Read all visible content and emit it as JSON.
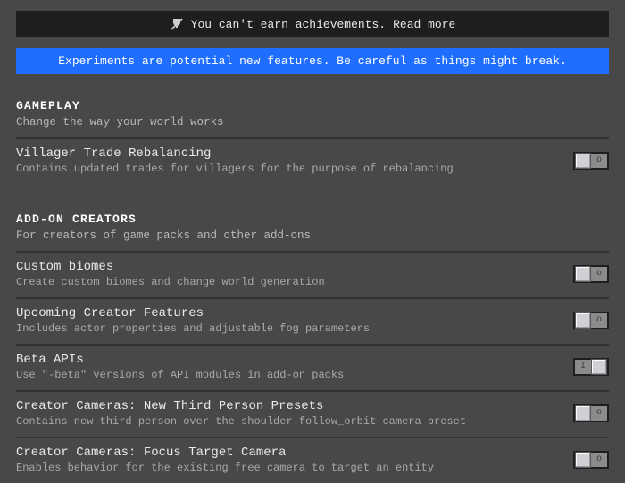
{
  "notice": {
    "icon_name": "trophy-disabled-icon",
    "text": "You can't earn achievements.",
    "link": "Read more"
  },
  "warning_banner": "Experiments are potential new features. Be careful as things might break.",
  "sections": [
    {
      "title": "GAMEPLAY",
      "subtitle": "Change the way your world works",
      "rows": [
        {
          "title": "Villager Trade Rebalancing",
          "desc": "Contains updated trades for villagers for the purpose of rebalancing",
          "on": false
        }
      ]
    },
    {
      "title": "ADD-ON CREATORS",
      "subtitle": "For creators of game packs and other add-ons",
      "rows": [
        {
          "title": "Custom biomes",
          "desc": "Create custom biomes and change world generation",
          "on": false
        },
        {
          "title": "Upcoming Creator Features",
          "desc": "Includes actor properties and adjustable fog parameters",
          "on": false
        },
        {
          "title": "Beta APIs",
          "desc": "Use \"-beta\" versions of API modules in add-on packs",
          "on": true
        },
        {
          "title": "Creator Cameras: New Third Person Presets",
          "desc": "Contains new third person over the shoulder follow_orbit camera preset",
          "on": false
        },
        {
          "title": "Creator Cameras: Focus Target Camera",
          "desc": "Enables behavior for the existing free camera to target an entity",
          "on": false
        }
      ]
    }
  ]
}
